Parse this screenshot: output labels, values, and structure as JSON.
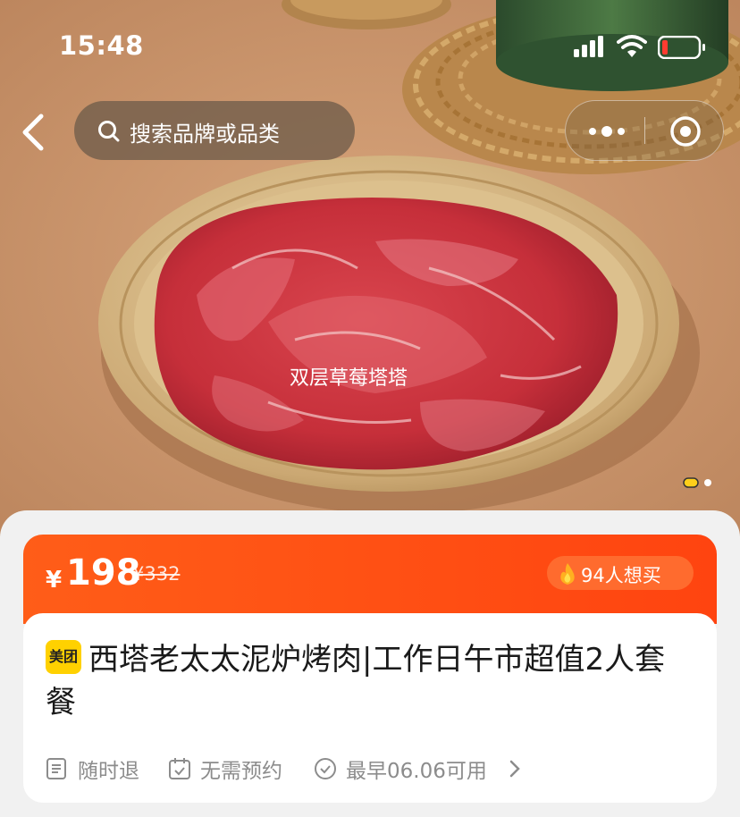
{
  "status_bar": {
    "time": "15:48"
  },
  "search": {
    "placeholder": "搜索品牌或品类"
  },
  "banner": {
    "caption": "双层草莓塔塔",
    "page_count": 2,
    "current_page": 1
  },
  "price": {
    "currency": "¥",
    "current": "198",
    "original": "¥332",
    "wants": "94人想买"
  },
  "deal": {
    "brand_badge": "美团",
    "title": "西塔老太太泥炉烤肉|工作日午市超值2人套餐",
    "features": [
      {
        "icon": "receipt-icon",
        "label": "随时退"
      },
      {
        "icon": "calendar-check-icon",
        "label": "无需预约"
      },
      {
        "icon": "check-circle-icon",
        "label": "最早06.06可用"
      }
    ]
  },
  "colors": {
    "accent": "#ff4f14",
    "brand_yellow": "#ffd100"
  }
}
